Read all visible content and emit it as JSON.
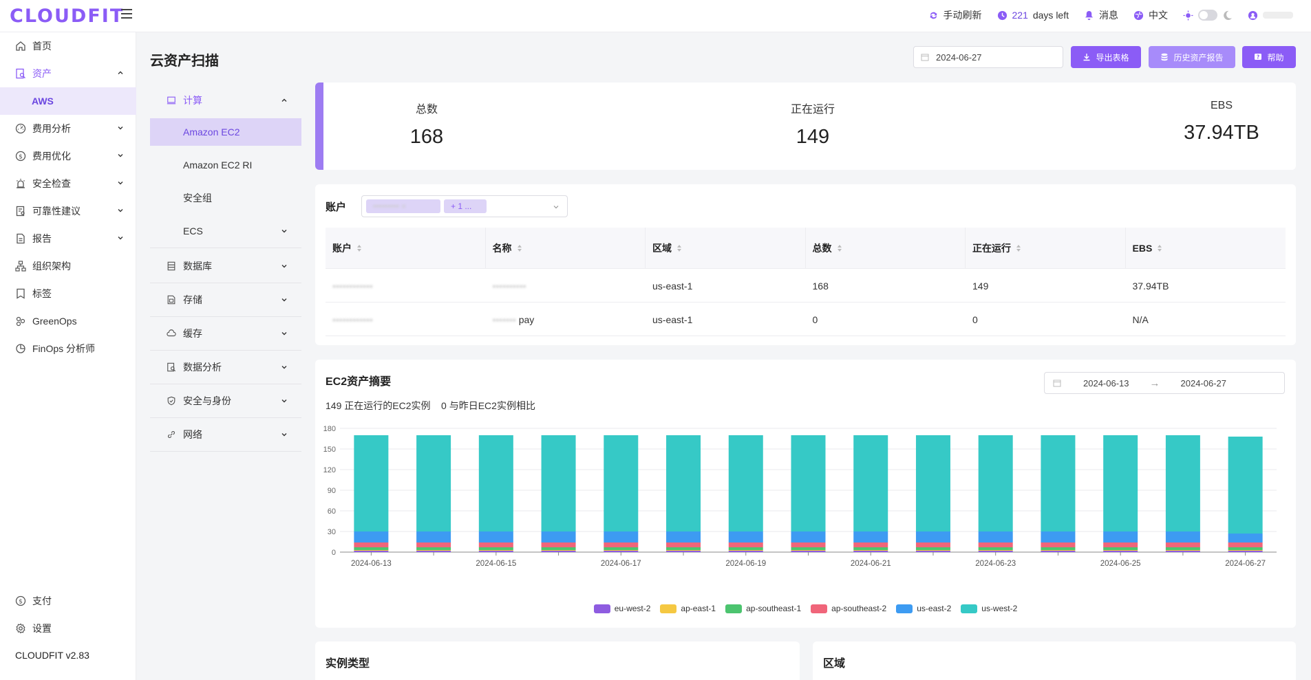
{
  "app": {
    "logo": "CLOUDFIT",
    "version": "CLOUDFIT v2.83"
  },
  "topbar": {
    "refresh": "手动刷新",
    "days_count": "221",
    "days_suffix": "days left",
    "messages": "消息",
    "language": "中文"
  },
  "sidebar": {
    "items": [
      {
        "label": "首页",
        "icon": "home-icon"
      },
      {
        "label": "资产",
        "icon": "asset-icon",
        "active": true
      },
      {
        "label": "AWS",
        "sub": true
      },
      {
        "label": "费用分析",
        "icon": "cost-analysis-icon"
      },
      {
        "label": "费用优化",
        "icon": "dollar-icon"
      },
      {
        "label": "安全检查",
        "icon": "alarm-icon"
      },
      {
        "label": "可靠性建议",
        "icon": "reliability-icon"
      },
      {
        "label": "报告",
        "icon": "report-icon"
      },
      {
        "label": "组织架构",
        "icon": "org-icon"
      },
      {
        "label": "标签",
        "icon": "tag-icon"
      },
      {
        "label": "GreenOps",
        "icon": "leaf-icon"
      },
      {
        "label": "FinOps 分析师",
        "icon": "analyst-icon"
      }
    ],
    "bottom": [
      {
        "label": "支付",
        "icon": "dollar-icon"
      },
      {
        "label": "设置",
        "icon": "gear-icon"
      }
    ]
  },
  "page": {
    "title": "云资产扫描"
  },
  "subnav": {
    "compute": "计算",
    "compute_items": [
      "Amazon EC2",
      "Amazon EC2 RI",
      "安全组",
      "ECS"
    ],
    "groups": [
      "数据库",
      "存储",
      "缓存",
      "数据分析",
      "安全与身份",
      "网络"
    ]
  },
  "actions": {
    "date": "2024-06-27",
    "export": "导出表格",
    "history": "历史资产报告",
    "help": "帮助"
  },
  "stats": [
    {
      "label": "总数",
      "value": "168"
    },
    {
      "label": "正在运行",
      "value": "149"
    },
    {
      "label": "EBS",
      "value": "37.94TB"
    }
  ],
  "accounts": {
    "label": "账户",
    "tag_more": "+ 1 ...",
    "columns": [
      "账户",
      "名称",
      "区域",
      "总数",
      "正在运行",
      "EBS"
    ],
    "rows": [
      [
        "",
        "",
        "us-east-1",
        "168",
        "149",
        "37.94TB"
      ],
      [
        "",
        "pay",
        "us-east-1",
        "0",
        "0",
        "N/A"
      ]
    ]
  },
  "ec2_summary": {
    "title": "EC2资产摘要",
    "running_text": "149 正在运行的EC2实例",
    "compare_text": "0 与昨日EC2实例相比",
    "range_start": "2024-06-13",
    "range_end": "2024-06-27"
  },
  "chart_data": {
    "type": "bar",
    "stacked": true,
    "categories": [
      "2024-06-13",
      "2024-06-14",
      "2024-06-15",
      "2024-06-16",
      "2024-06-17",
      "2024-06-18",
      "2024-06-19",
      "2024-06-20",
      "2024-06-21",
      "2024-06-22",
      "2024-06-23",
      "2024-06-24",
      "2024-06-25",
      "2024-06-26",
      "2024-06-27"
    ],
    "x_tick_labels": [
      "2024-06-13",
      "2024-06-15",
      "2024-06-17",
      "2024-06-19",
      "2024-06-21",
      "2024-06-23",
      "2024-06-25",
      "2024-06-27"
    ],
    "y_ticks": [
      0,
      30,
      60,
      90,
      120,
      150,
      180
    ],
    "ylim": [
      0,
      180
    ],
    "grid": true,
    "legend_position": "bottom",
    "series": [
      {
        "name": "eu-west-2",
        "color": "#8e5ce0",
        "values": [
          2,
          2,
          2,
          2,
          2,
          2,
          2,
          2,
          2,
          2,
          2,
          2,
          2,
          2,
          2
        ]
      },
      {
        "name": "ap-east-1",
        "color": "#f5c842",
        "values": [
          1,
          1,
          1,
          1,
          1,
          1,
          1,
          1,
          1,
          1,
          1,
          1,
          1,
          1,
          1
        ]
      },
      {
        "name": "ap-southeast-1",
        "color": "#4cc46f",
        "values": [
          4,
          4,
          4,
          4,
          4,
          4,
          4,
          4,
          4,
          4,
          4,
          4,
          4,
          4,
          4
        ]
      },
      {
        "name": "ap-southeast-2",
        "color": "#f0657a",
        "values": [
          7,
          7,
          7,
          7,
          7,
          7,
          7,
          7,
          7,
          7,
          7,
          7,
          7,
          7,
          7
        ]
      },
      {
        "name": "us-east-2",
        "color": "#3d9bf2",
        "values": [
          16,
          16,
          16,
          16,
          16,
          16,
          16,
          16,
          16,
          16,
          16,
          16,
          16,
          16,
          13
        ]
      },
      {
        "name": "us-west-2",
        "color": "#36c9c6",
        "values": [
          140,
          140,
          140,
          140,
          140,
          140,
          140,
          140,
          140,
          140,
          140,
          140,
          140,
          140,
          141
        ]
      }
    ]
  },
  "bottom_cards": {
    "instance_type": "实例类型",
    "region": "区域"
  }
}
